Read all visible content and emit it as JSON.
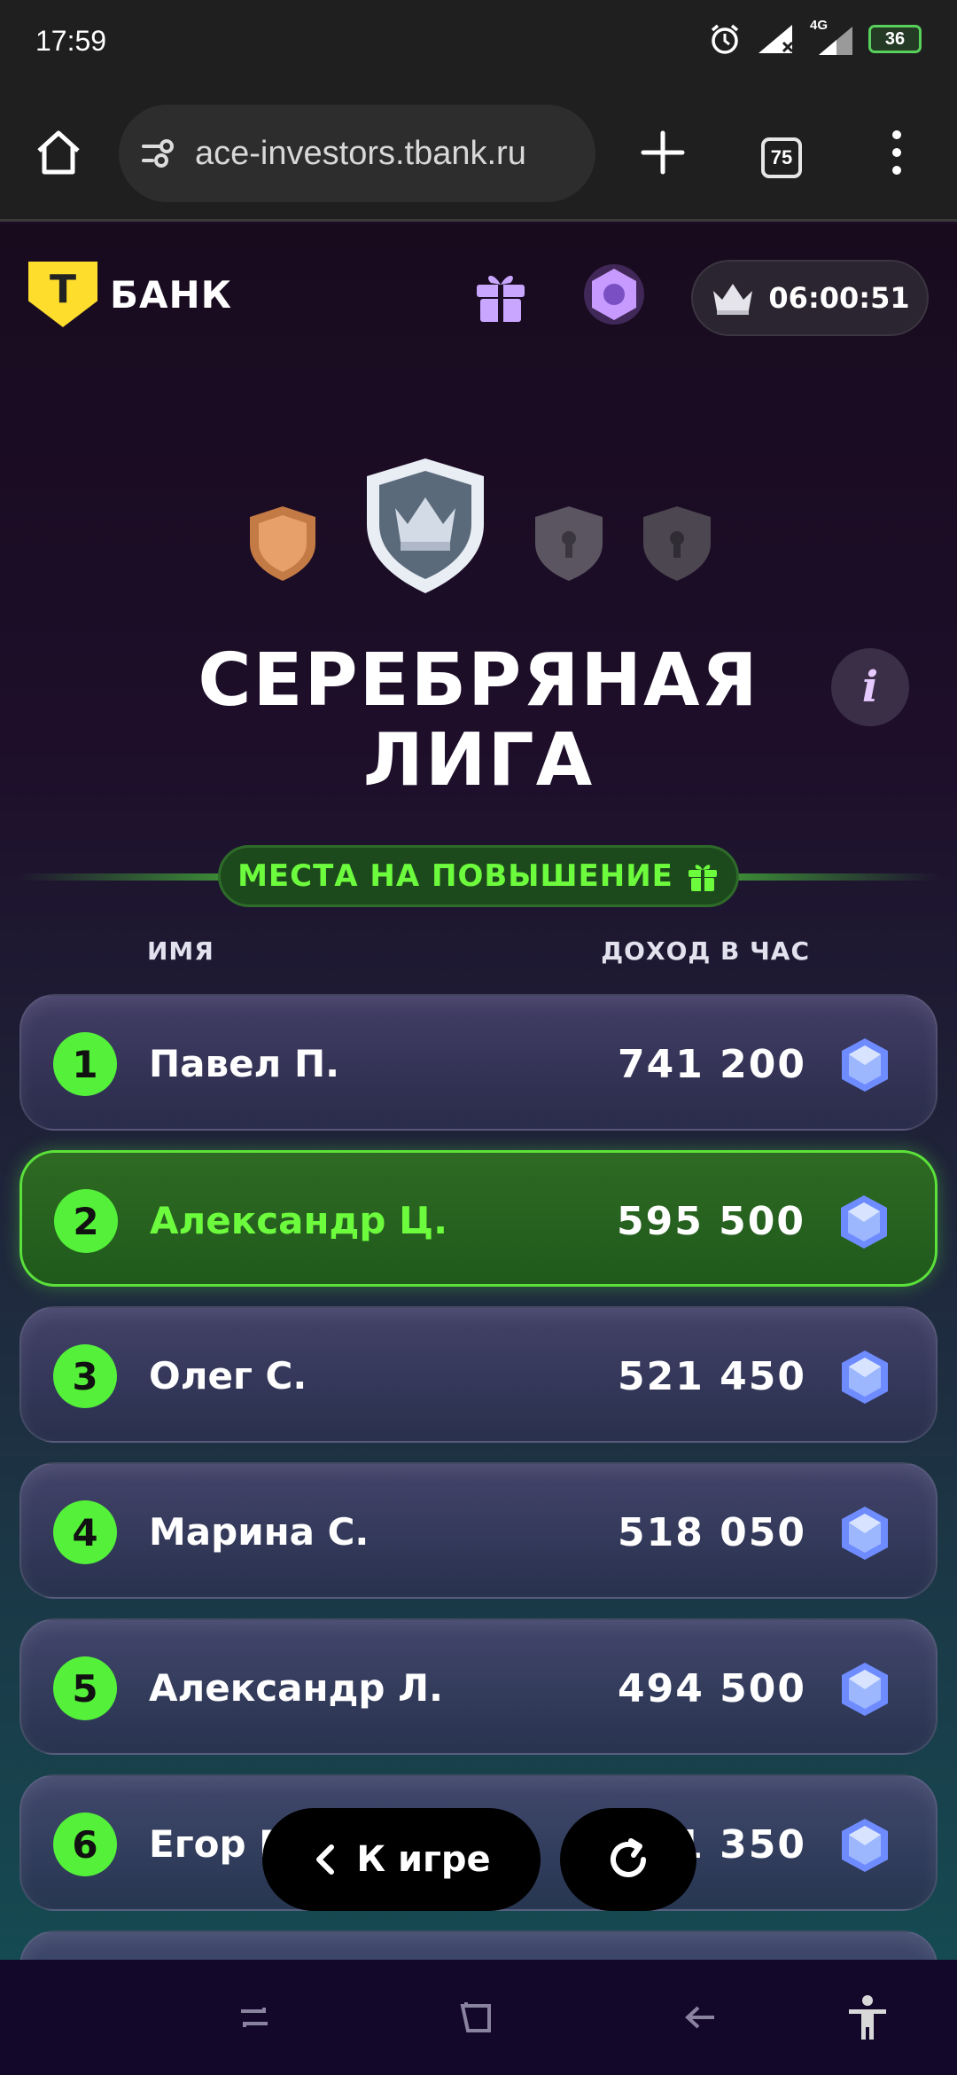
{
  "status_bar": {
    "time": "17:59",
    "network": "4G",
    "battery": "36",
    "icons": [
      "alarm-icon",
      "signal-icon",
      "signal-icon",
      "battery-icon"
    ]
  },
  "browser": {
    "url": "ace-investors.tbank.ru",
    "tabs_count": "75",
    "icons": [
      "home-icon",
      "site-settings-icon",
      "new-tab-icon",
      "menu-icon"
    ]
  },
  "header": {
    "brand": {
      "letter": "Т",
      "name": "БАНК"
    },
    "timer": "06:00:51",
    "icons": [
      "gift-icon",
      "nut-icon",
      "crown-icon"
    ]
  },
  "league": {
    "title_line1": "СЕРЕБРЯНАЯ",
    "title_line2": "ЛИГА",
    "info_label": "i",
    "badges": [
      "bronze",
      "silver",
      "locked",
      "locked"
    ],
    "promotion_label": "МЕСТА НА ПОВЫШЕНИЕ"
  },
  "table": {
    "col_name": "ИМЯ",
    "col_income": "ДОХОД В ЧАС",
    "rows": [
      {
        "rank": "1",
        "name": "Павел П.",
        "income": "741 200",
        "highlight": false
      },
      {
        "rank": "2",
        "name": "Александр Ц.",
        "income": "595 500",
        "highlight": true
      },
      {
        "rank": "3",
        "name": "Олег С.",
        "income": "521 450",
        "highlight": false
      },
      {
        "rank": "4",
        "name": "Марина С.",
        "income": "518 050",
        "highlight": false
      },
      {
        "rank": "5",
        "name": "Александр Л.",
        "income": "494 500",
        "highlight": false
      },
      {
        "rank": "6",
        "name": "Егор П",
        "income": "51 350",
        "highlight": false
      }
    ]
  },
  "bottom_actions": {
    "back_label": "К игре",
    "icons": [
      "chevron-left-icon",
      "refresh-icon"
    ]
  },
  "colors": {
    "accent_green": "#55f03a",
    "brand_yellow": "#ffdd2d",
    "highlight_text": "#6dfb3d"
  }
}
